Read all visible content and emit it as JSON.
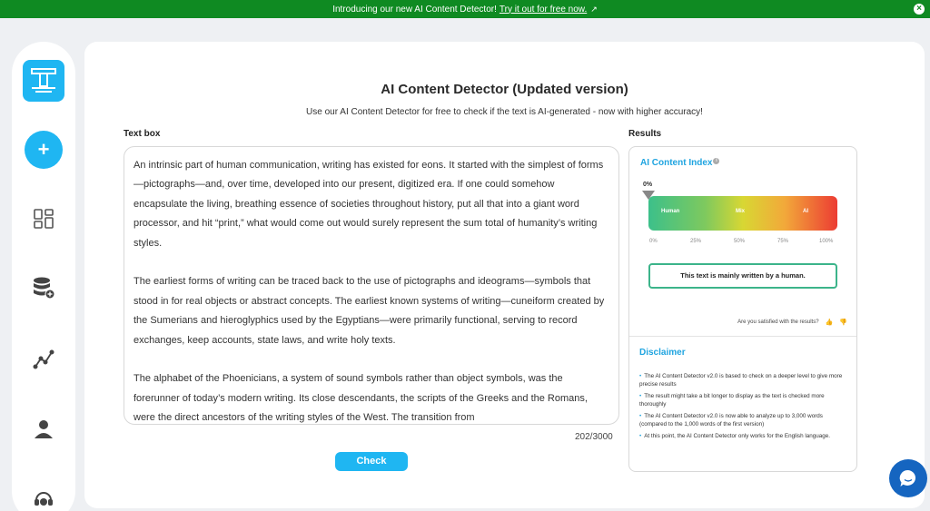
{
  "banner": {
    "text": "Introducing our new AI Content Detector!",
    "link": "Try it out for free now.",
    "close_icon": "×"
  },
  "sidebar": {
    "logo_icon": "T-logo",
    "add_label": "+",
    "icons": [
      "dashboard-icon",
      "database-add-icon",
      "analytics-icon",
      "user-icon",
      "support-icon"
    ]
  },
  "main": {
    "title": "AI Content Detector (Updated version)",
    "subtitle": "Use our AI Content Detector for free to check if the text is AI-generated - now with higher accuracy!",
    "textbox_label": "Text box",
    "results_label": "Results",
    "paragraphs": [
      "An intrinsic part of human communication, writing has existed for eons. It started with the simplest of forms—pictographs—and, over time, developed into our present, digitized era. If one could somehow encapsulate the living, breathing essence of societies throughout history, put all that into a giant word processor, and hit “print,” what would come out would surely represent the sum total of humanity’s writing styles.",
      "The earliest forms of writing can be traced back to the use of pictographs and ideograms—symbols that stood in for real objects or abstract concepts. The earliest known systems of writing—cuneiform created by the Sumerians and hieroglyphics used by the Egyptians—were primarily functional, serving to record exchanges, keep accounts, state laws, and write holy texts.",
      "The alphabet of the Phoenicians, a system of sound symbols rather than object symbols, was the forerunner of today’s modern writing. Its close descendants, the scripts of the Greeks and the Romans, were the direct ancestors of the writing styles of the West. The transition from"
    ],
    "counter": "202/3000",
    "check_label": "Check"
  },
  "results": {
    "index_title": "AI Content Index",
    "info_icon": "i",
    "ai_percent_label": "0%",
    "ai_percent": 0,
    "zones": [
      "Human",
      "Mix",
      "AI"
    ],
    "ticks": [
      "0%",
      "25%",
      "50%",
      "75%",
      "100%"
    ],
    "verdict": "This text is mainly written by a human.",
    "satisfied": "Are you satisfied with the results?",
    "thumb_up": "👍",
    "thumb_down": "👎",
    "disclaimer_title": "Disclaimer",
    "disclaimer_items": [
      "The AI Content Detector v2.0 is based to check on a deeper level to give more precise results",
      "The result might take a bit longer to display as the text is checked more thoroughly",
      "The AI Content Detector v2.0 is now able to analyze up to 3,000 words (compared to the 1,000 words of the first version)",
      "At this point, the AI Content Detector only works for the English language."
    ],
    "bullet": "•"
  },
  "colors": {
    "accent": "#1fb6f2",
    "banner": "#0f8a22",
    "chat": "#1565c0"
  }
}
